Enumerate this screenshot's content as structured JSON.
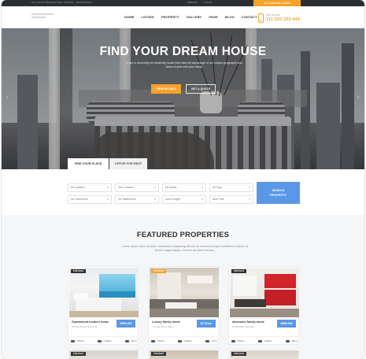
{
  "topbar": {
    "left_text": "DAY FOUR PREMIUM REAL ESTATE · WORLDWIDE",
    "links": [
      "SIGN UP",
      "LOG IN"
    ],
    "cta": "GET PREMIUM LISTING"
  },
  "nav": {
    "items": [
      "HOME",
      "LISTING",
      "PROPERTY",
      "GALLERY",
      "PAGE",
      "BLOG",
      "CONTACT"
    ]
  },
  "call": {
    "label": "Call us now",
    "number": "111 222 333 444"
  },
  "hero": {
    "title": "FIND YOUR DREAM HOUSE",
    "text": "If you're searching for dreaming house then take full advantage of our unique geography and views of area with your family.",
    "primary_button": "VIEW DETAILS",
    "secondary_button": "GET A QUOTE",
    "prev_icon": "chevron-left-icon",
    "next_icon": "chevron-right-icon"
  },
  "tabs": [
    "FIND YOUR PLACE",
    "OFFICE FOR RENT"
  ],
  "search": {
    "selects": [
      "All Location",
      "Sub Location",
      "All Status",
      "All Type",
      "No. Bedrooms",
      "No. Bathrooms",
      "Area Length",
      "Max Price"
    ],
    "button_line1": "SEARCH",
    "button_line2": "PROPERTY"
  },
  "featured": {
    "title": "FEATURED PROPERTIES",
    "subtitle": "Lorem ipsum dolor sit amet, consectetur adipiscing elit sed do eiusmod tempor incididunt ut labore et dolore magna aliqua. Ut enim ad minim veniam."
  },
  "cards": [
    {
      "tag": "FOR SALE",
      "name": "Guaranteed modern home",
      "address": "18 Park Street, New York",
      "price": "$380,000",
      "meta": [
        "3 Beds",
        "2 Baths",
        "320 ft"
      ]
    },
    {
      "tag": "FOR RENT",
      "name": "Luxury family home",
      "address": "1 Ocean Drive, Miami",
      "price": "$770/mo",
      "meta": [
        "4 Beds",
        "3 Baths",
        "410 ft"
      ]
    },
    {
      "tag": "FOR SALE",
      "name": "Awesome family home",
      "address": "22 Hill Road, Chicago",
      "price": "$580,000",
      "meta": [
        "3 Beds",
        "2 Baths",
        "350 ft"
      ]
    }
  ],
  "cards_row2": [
    {
      "tag": "FOR SALE"
    },
    {
      "tag": "FOR RENT"
    },
    {
      "tag": "FOR SALE"
    }
  ],
  "colors": {
    "accent": "#f6a22b",
    "blue": "#5a97e6",
    "dark": "#2b2e33"
  }
}
